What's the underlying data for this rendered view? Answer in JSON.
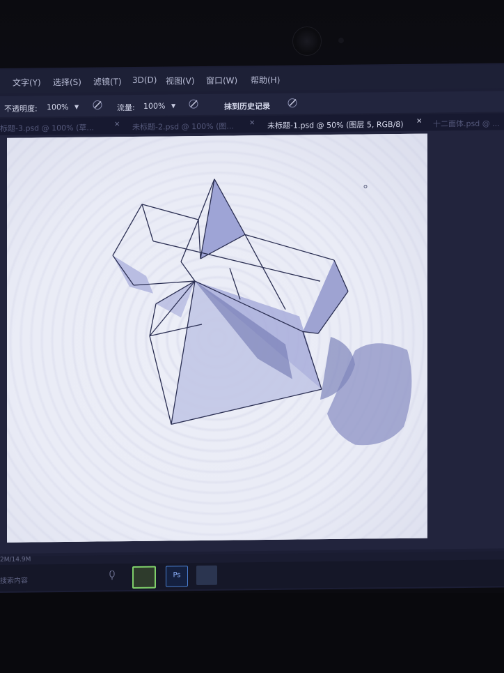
{
  "menu": {
    "items": [
      "文字(Y)",
      "选择(S)",
      "滤镜(T)",
      "3D(D)",
      "视图(V)",
      "窗口(W)",
      "帮助(H)"
    ]
  },
  "options": {
    "opacity_label": "不透明度:",
    "opacity_value": "100%",
    "flow_label": "流量:",
    "flow_value": "100%",
    "erase_history_label": "抹到历史记录"
  },
  "tabs": [
    {
      "label": "标题-3.psd @ 100% (草..."
    },
    {
      "label": "未标题-2.psd @ 100% (图..."
    },
    {
      "label": "未标题-1.psd @ 50% (图层 5, RGB/8)"
    },
    {
      "label": "十二面体.psd @ ..."
    }
  ],
  "status": {
    "doc_size": "2M/14.9M",
    "search_hint": "搜索内容"
  },
  "taskbar": {
    "apps": [
      "ps-app-icon-green",
      "photoshop-icon",
      "photo-viewer-icon"
    ]
  },
  "colors": {
    "menubar": "#1d2036",
    "canvas": "#e9ebf5",
    "shade": "#8c92c4",
    "line": "#2a2e52",
    "accent_active_tab": "#d8dbee"
  }
}
